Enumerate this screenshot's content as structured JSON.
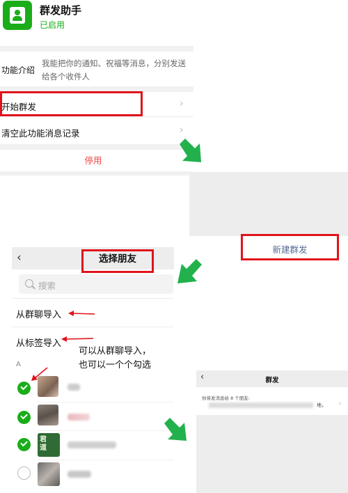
{
  "assistant": {
    "title": "群发助手",
    "status": "已启用",
    "intro_label": "功能介绍",
    "intro_text": "我能把你的通知、祝福等消息，分别发送给各个收件人",
    "start_label": "开始群发",
    "clear_label": "清空此功能消息记录",
    "disable_label": "停用",
    "chevron": "›"
  },
  "new_send": {
    "label": "新建群发"
  },
  "select_friends": {
    "title": "选择朋友",
    "back": "‹",
    "search_placeholder": "搜索",
    "from_group": "从群聊导入",
    "from_tag": "从标签导入",
    "index_letter": "A",
    "annotation_line1": "可以从群聊导入，",
    "annotation_line2": "也可以一个个勾选",
    "contacts": [
      {
        "checked": true
      },
      {
        "checked": true
      },
      {
        "checked": true,
        "avatar_text": "君\n道"
      },
      {
        "checked": false
      }
    ]
  },
  "group_send": {
    "title": "群发",
    "back": "‹",
    "info": "你将发消息给 8 个朋友:",
    "names_tail": "地，",
    "chevron": "›"
  },
  "colors": {
    "wechat_green": "#1aad19",
    "annotation_red": "#e0131a",
    "arrow_green": "#22b14c",
    "link_blue": "#576b95",
    "danger_red": "#ee4444"
  }
}
